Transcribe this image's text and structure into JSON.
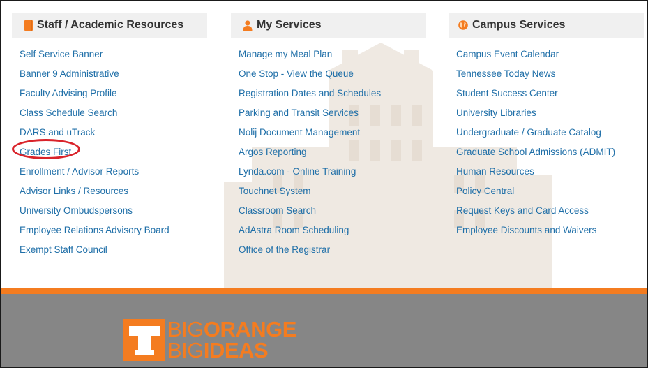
{
  "colors": {
    "link": "#1f6fa8",
    "accent_orange": "#f47c20",
    "footer_gray": "#868686",
    "highlight_circle": "#d9232a"
  },
  "columns": [
    {
      "header": "Staff / Academic Resources",
      "icon": "book-icon",
      "links": [
        "Self Service Banner",
        "Banner 9 Administrative",
        "Faculty Advising Profile",
        "Class Schedule Search",
        "DARS and uTrack",
        "Grades First",
        "Enrollment / Advisor Reports",
        "Advisor Links / Resources",
        "University Ombudspersons",
        "Employee Relations Advisory Board",
        "Exempt Staff Council"
      ]
    },
    {
      "header": "My Services",
      "icon": "user-icon",
      "links": [
        "Manage my Meal Plan",
        "One Stop - View the Queue",
        "Registration Dates and Schedules",
        "Parking and Transit Services",
        "Nolij Document Management",
        "Argos Reporting",
        "Lynda.com - Online Training",
        "Touchnet System",
        "Classroom Search",
        "AdAstra Room Scheduling",
        "Office of the Registrar"
      ]
    },
    {
      "header": "Campus Services",
      "icon": "globe-icon",
      "links": [
        "Campus Event Calendar",
        "Tennessee Today News",
        "Student Success Center",
        "University Libraries",
        "Undergraduate / Graduate Catalog",
        "Graduate School Admissions (ADMIT)",
        "Human Resources",
        "Policy Central",
        "Request Keys and Card Access",
        "Employee Discounts and Waivers"
      ]
    }
  ],
  "annotation": {
    "circled_link": "Grades First"
  },
  "footer": {
    "logo": {
      "line1_thin": "BIG",
      "line1_bold": "ORANGE",
      "line2_thin": "BIG",
      "line2_bold": "IDEAS"
    }
  }
}
